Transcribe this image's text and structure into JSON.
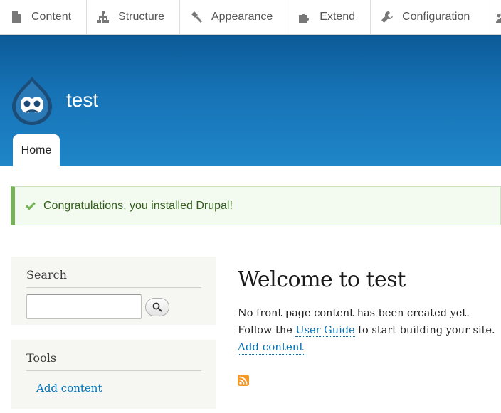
{
  "toolbar": {
    "items": [
      {
        "label": "Content",
        "icon": "content-icon"
      },
      {
        "label": "Structure",
        "icon": "structure-icon"
      },
      {
        "label": "Appearance",
        "icon": "appearance-icon"
      },
      {
        "label": "Extend",
        "icon": "extend-icon"
      },
      {
        "label": "Configuration",
        "icon": "configuration-icon"
      },
      {
        "label": "",
        "icon": "people-icon"
      }
    ]
  },
  "header": {
    "site_name": "test",
    "logo_icon": "drupal-logo",
    "tabs": [
      {
        "label": "Home"
      }
    ]
  },
  "message": {
    "text": "Congratulations, you installed Drupal!",
    "icon": "check-icon",
    "color": "#77b259"
  },
  "sidebar": {
    "search": {
      "title": "Search",
      "input_value": "",
      "button_icon": "search-icon"
    },
    "tools": {
      "title": "Tools",
      "link": "Add content"
    }
  },
  "main": {
    "title": "Welcome to test",
    "line1": "No front page content has been created yet.",
    "line2_prefix": "Follow the ",
    "user_guide_link": "User Guide",
    "line2_suffix": " to start building your site.",
    "add_content_link": "Add content",
    "feed_icon": "rss-icon"
  },
  "colors": {
    "header_top": "#0c5a96",
    "header_bottom": "#1f86c8",
    "link": "#0071b3",
    "feed": "#f29824"
  }
}
